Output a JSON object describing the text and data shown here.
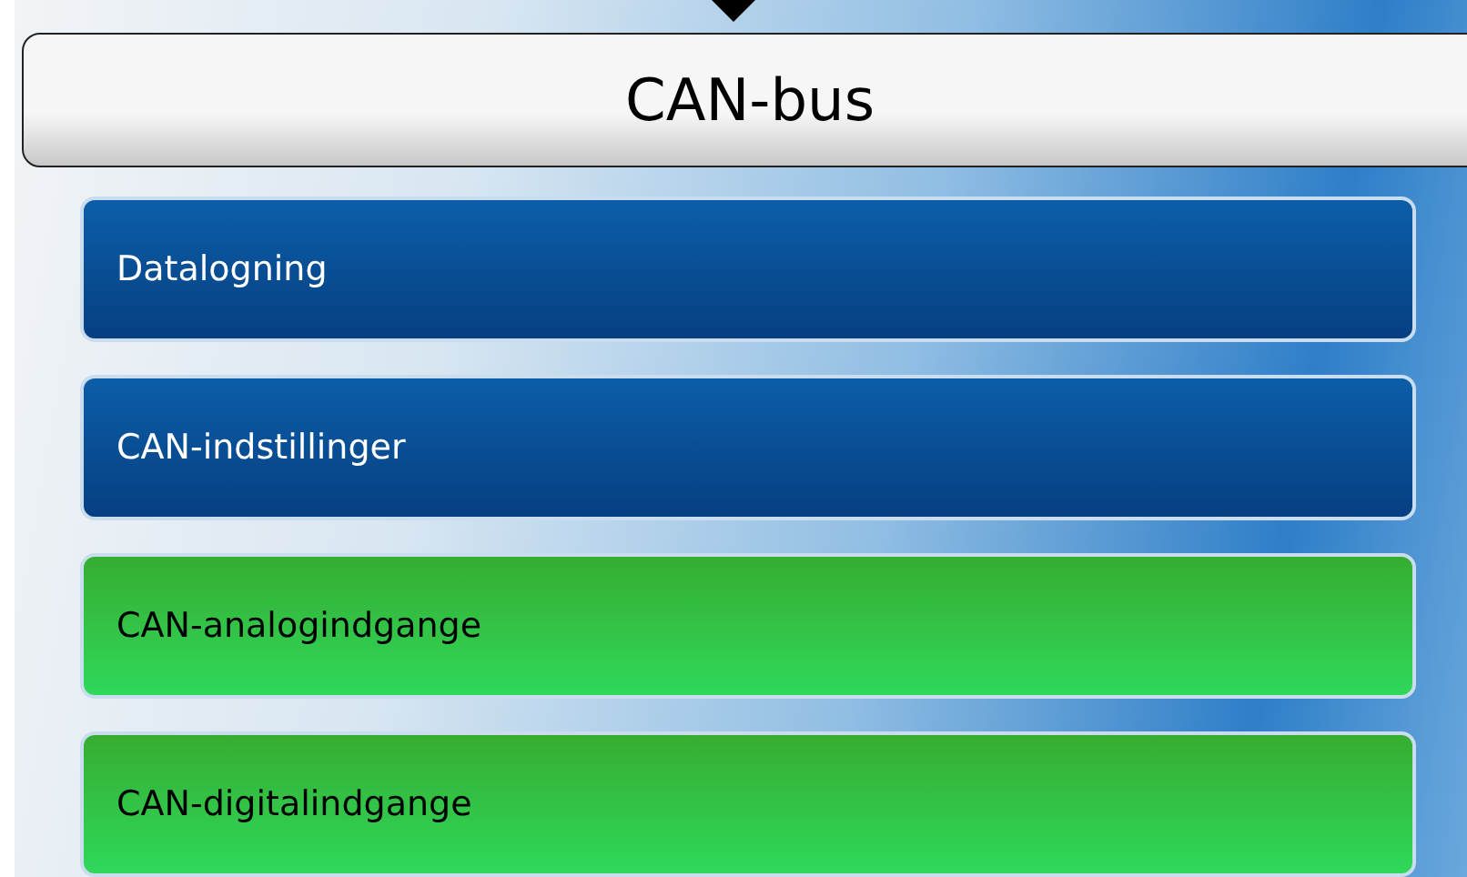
{
  "header": {
    "title": "CAN-bus"
  },
  "menu": [
    {
      "label": "Datalogning",
      "kind": "menu"
    },
    {
      "label": "CAN-indstillinger",
      "kind": "menu"
    },
    {
      "label": "CAN-analogindgange",
      "kind": "inputs"
    },
    {
      "label": "CAN-digitalindgange",
      "kind": "inputs"
    }
  ]
}
